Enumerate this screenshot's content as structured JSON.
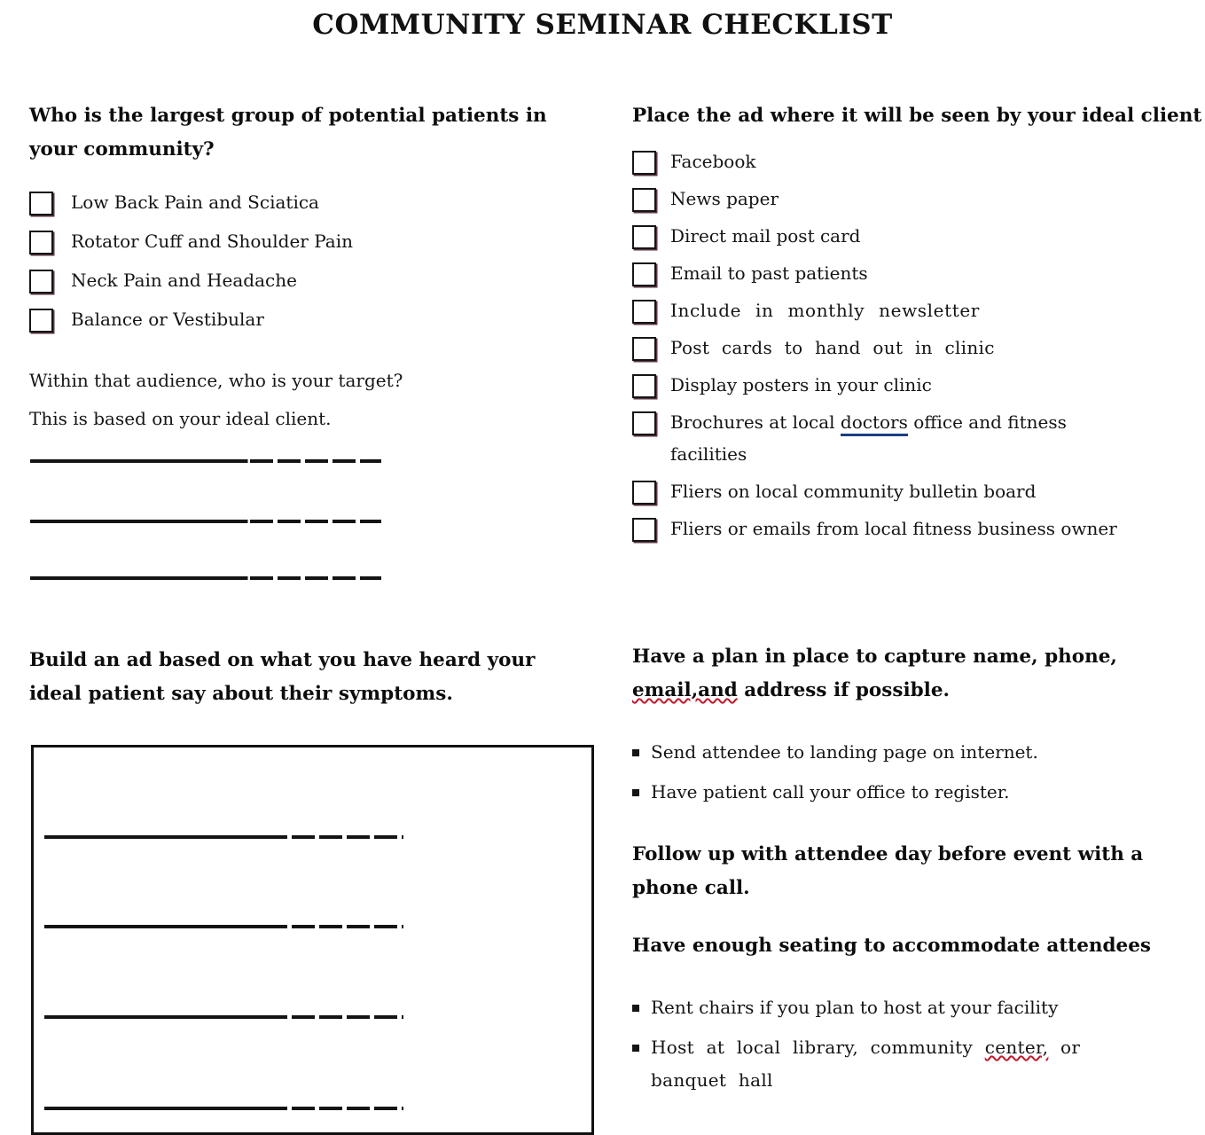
{
  "document": {
    "title": "COMMUNITY SEMINAR CHECKLIST"
  },
  "left_column": {
    "section1": {
      "heading_line1": "Who is the largest group of potential patients in",
      "heading_line2": "your community?",
      "checklist": [
        {
          "label": "Low Back Pain and Sciatica",
          "checked": false
        },
        {
          "label": "Rotator Cuff and Shoulder Pain",
          "checked": false
        },
        {
          "label": "Neck Pain and Headache",
          "checked": false
        },
        {
          "label": "Balance or Vestibular",
          "checked": false
        }
      ]
    },
    "section2": {
      "prompt_line1": "Within that audience, who is your target?",
      "prompt_line2": "This is based on your ideal client.",
      "answer_lines": 3
    },
    "section3": {
      "heading_line1": "Build an ad based on what you have heard your",
      "heading_line2": "ideal patient say about their symptoms.",
      "answer_box_lines": 4
    }
  },
  "right_column": {
    "section1": {
      "heading": "Place the ad where it will be seen by your ideal client",
      "checklist": [
        {
          "label": "Facebook",
          "checked": false
        },
        {
          "label": "News paper",
          "checked": false
        },
        {
          "label": "Direct mail post card",
          "checked": false
        },
        {
          "label": "Email to past patients",
          "checked": false
        },
        {
          "label": "Include in monthly newsletter",
          "checked": false
        },
        {
          "label": "Post cards to hand out in clinic",
          "checked": false
        },
        {
          "label": "Display posters in your clinic",
          "checked": false
        },
        {
          "label_prefix": "Brochures at local ",
          "label_flagged": "doctors",
          "label_suffix": " office and fitness",
          "label_line2": "facilities",
          "checked": false
        },
        {
          "label": "Fliers on local community bulletin board",
          "checked": false
        },
        {
          "label": "Fliers or emails from local fitness business owner",
          "checked": false
        }
      ]
    },
    "section2": {
      "heading_line1": "Have a plan in place to capture name, phone,",
      "heading_line2_flagged": "email,and",
      "heading_line2_rest": " address if possible.",
      "bullets": [
        "Send attendee to landing page on internet.",
        "Have patient call your office to register."
      ]
    },
    "section3": {
      "heading_line1": "Follow up with attendee day before event with a",
      "heading_line2": "phone call."
    },
    "section4": {
      "heading": "Have enough seating to accommodate attendees",
      "bullets": [
        {
          "text": "Rent chairs if you plan to host at your facility"
        },
        {
          "text_prefix": "Host at local library, community ",
          "text_flagged": "center,",
          "text_suffix": " or",
          "text_line2": "banquet hall"
        }
      ]
    }
  },
  "colors": {
    "ink": "#141414",
    "spellcheck_red": "#c0182b",
    "hyperlink_blue": "#1c3f86"
  }
}
